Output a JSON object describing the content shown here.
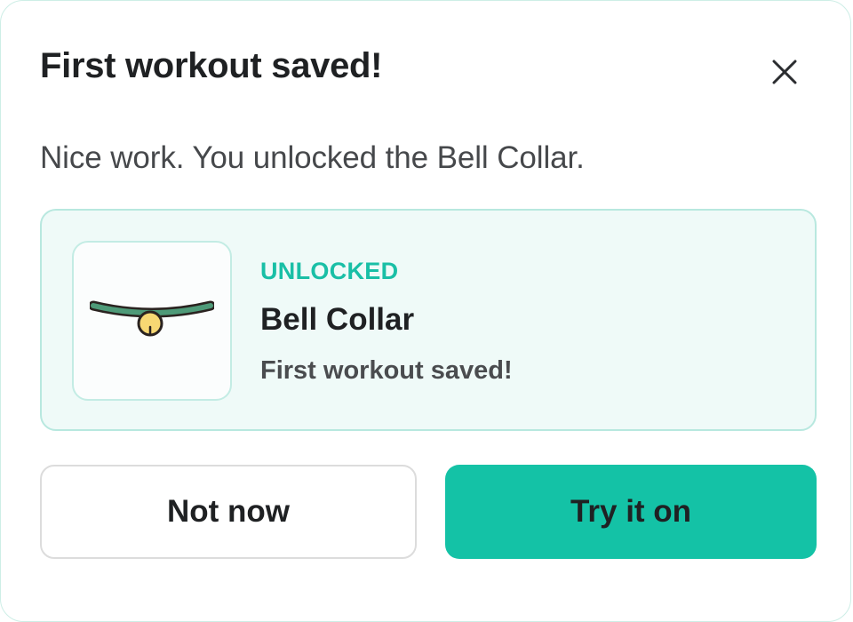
{
  "dialog": {
    "title": "First workout saved!",
    "close_icon": "close-icon",
    "message": "Nice work. You unlocked the Bell Collar."
  },
  "reward": {
    "image_icon": "bell-collar-icon",
    "status": "UNLOCKED",
    "name": "Bell Collar",
    "description": "First workout saved!"
  },
  "actions": {
    "secondary_label": "Not now",
    "primary_label": "Try it on"
  },
  "colors": {
    "accent": "#14c2a6",
    "status_text": "#19bfa6",
    "card_background": "#effaf8",
    "collar_band": "#4e9a78",
    "bell": "#f7d873"
  }
}
